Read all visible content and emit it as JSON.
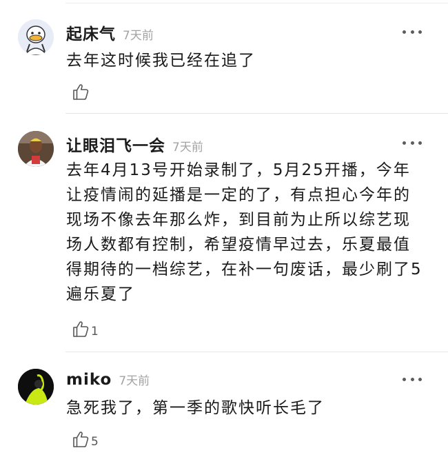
{
  "comments": [
    {
      "username": "起床气",
      "time": "7天前",
      "text": "去年这时候我已经在追了",
      "likes": ""
    },
    {
      "username": "让眼泪飞一会",
      "time": "7天前",
      "text": "去年4月13号开始录制了，5月25开播，今年让疫情闹的延播是一定的了，有点担心今年的现场不像去年那么炸，到目前为止所以综艺现场人数都有控制，希望疫情早过去，乐夏最值得期待的一档综艺，在补一句废话，最少刷了5遍乐夏了",
      "likes": "1"
    },
    {
      "username": "miko",
      "time": "7天前",
      "text": "急死我了，第一季的歌快听长毛了",
      "likes": "5"
    }
  ],
  "icons": {
    "more": "more-dots-icon",
    "like": "thumbs-up-icon"
  }
}
